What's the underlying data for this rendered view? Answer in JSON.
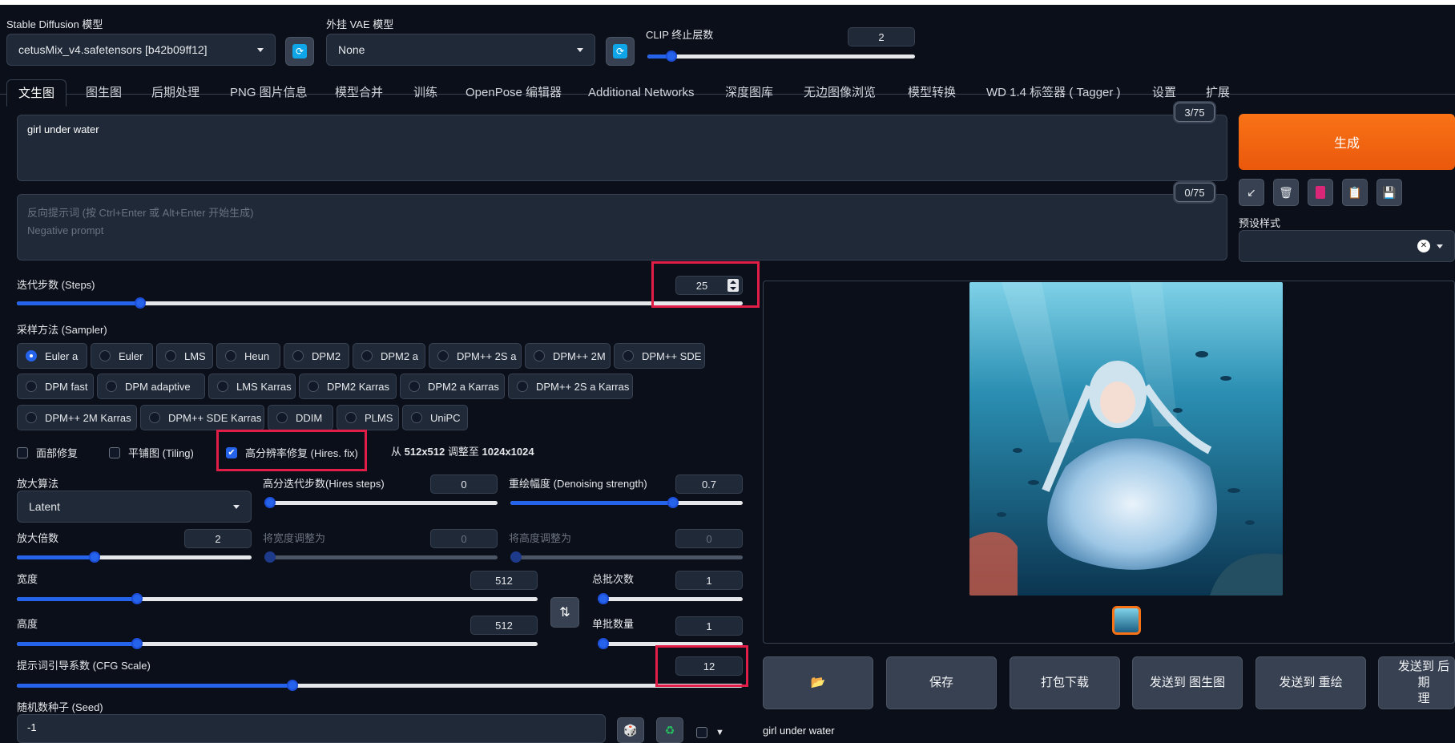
{
  "top": {
    "model_label": "Stable Diffusion 模型",
    "model_value": "cetusMix_v4.safetensors [b42b09ff12]",
    "vae_label": "外挂 VAE 模型",
    "vae_value": "None",
    "clip_label": "CLIP 终止层数",
    "clip_value": "2",
    "clip_fraction": 0.09
  },
  "tabs": [
    "文生图",
    "图生图",
    "后期处理",
    "PNG 图片信息",
    "模型合并",
    "训练",
    "OpenPose 编辑器",
    "Additional Networks",
    "深度图库",
    "无边图像浏览",
    "模型转换",
    "WD 1.4 标签器 ( Tagger )",
    "设置",
    "扩展"
  ],
  "prompt": {
    "value": "girl under water",
    "counter": "3/75",
    "neg_placeholder_1": "反向提示词 (按 Ctrl+Enter 或 Alt+Enter 开始生成)",
    "neg_placeholder_2": "Negative prompt",
    "neg_counter": "0/75"
  },
  "right_panel": {
    "generate_label": "生成",
    "tool_icons": [
      "arrow-icon",
      "trash-icon",
      "card-icon",
      "clipboard-icon",
      "save-icon"
    ],
    "styles_label": "预设样式",
    "clear_icon": "✕"
  },
  "steps": {
    "label": "迭代步数 (Steps)",
    "value": "25",
    "fraction": 0.17
  },
  "sampler": {
    "label": "采样方法 (Sampler)",
    "options": [
      "Euler a",
      "Euler",
      "LMS",
      "Heun",
      "DPM2",
      "DPM2 a",
      "DPM++ 2S a",
      "DPM++ 2M",
      "DPM++ SDE",
      "DPM fast",
      "DPM adaptive",
      "LMS Karras",
      "DPM2 Karras",
      "DPM2 a Karras",
      "DPM++ 2S a Karras",
      "DPM++ 2M Karras",
      "DPM++ SDE Karras",
      "DDIM",
      "PLMS",
      "UniPC"
    ],
    "selected": "Euler a"
  },
  "checks": {
    "face": "面部修复",
    "tiling": "平铺图 (Tiling)",
    "hires": "高分辨率修复 (Hires. fix)",
    "hires_info_prefix": "从",
    "hires_info_from": "512x512",
    "hires_info_mid": "调整至",
    "hires_info_to": "1024x1024"
  },
  "hires": {
    "upscaler_label": "放大算法",
    "upscaler_value": "Latent",
    "steps_label": "高分迭代步数(Hires steps)",
    "steps_value": "0",
    "steps_fraction": 0.0,
    "denoise_label": "重绘幅度 (Denoising strength)",
    "denoise_value": "0.7",
    "denoise_fraction": 0.7,
    "scale_label": "放大倍数",
    "scale_value": "2",
    "scale_fraction": 0.33,
    "resize_w_label": "将宽度调整为",
    "resize_w_value": "0",
    "resize_h_label": "将高度调整为",
    "resize_h_value": "0"
  },
  "size": {
    "width_label": "宽度",
    "width_value": "512",
    "width_fraction": 0.23,
    "height_label": "高度",
    "height_value": "512",
    "height_fraction": 0.23,
    "batch_count_label": "总批次数",
    "batch_count_value": "1",
    "batch_size_label": "单批数量",
    "batch_size_value": "1",
    "swap_icon": "⇅"
  },
  "cfg": {
    "label": "提示词引导系数 (CFG Scale)",
    "value": "12",
    "fraction": 0.38
  },
  "seed": {
    "label": "随机数种子 (Seed)",
    "value": "-1",
    "dice_icon": "🎲",
    "recycle_icon": "♻"
  },
  "output": {
    "caption": "girl under water",
    "buttons": [
      "📂",
      "保存",
      "打包下载",
      "发送到 图生图",
      "发送到 重绘",
      "发送到 后期\n理"
    ]
  }
}
